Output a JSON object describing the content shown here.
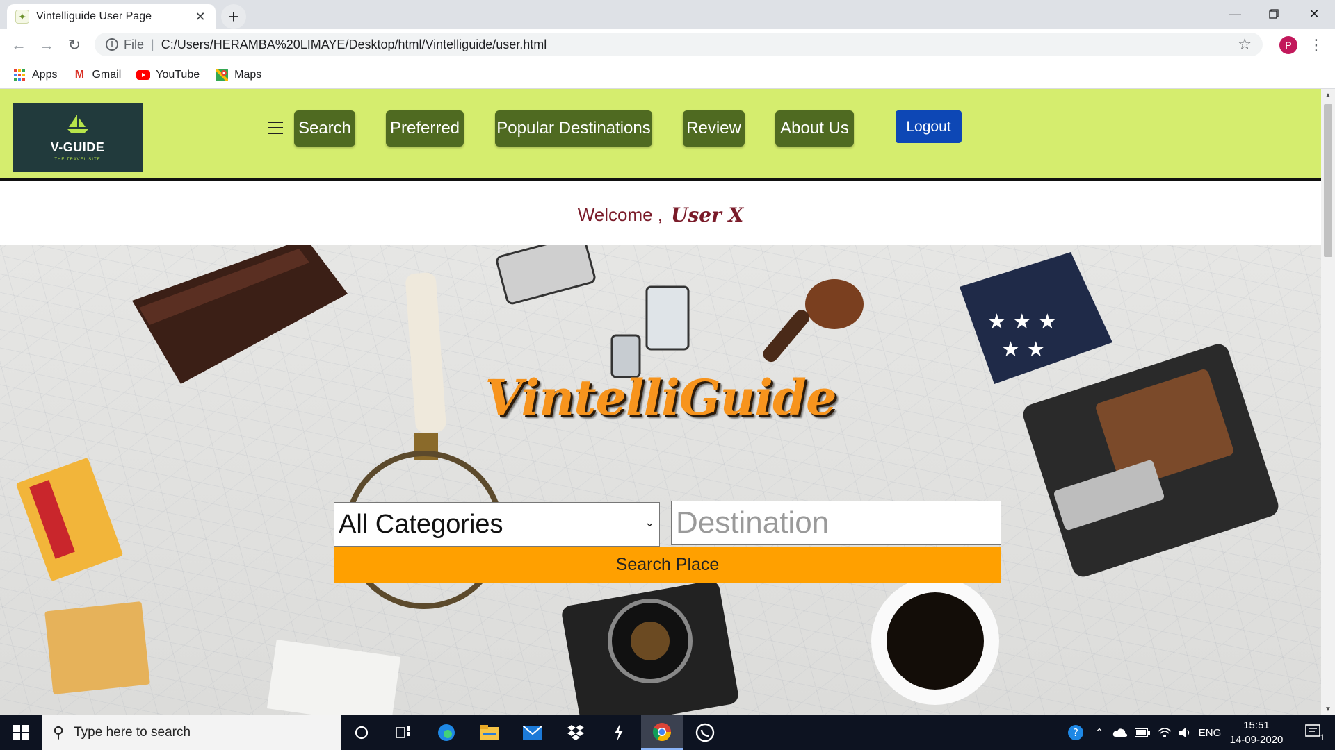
{
  "browser": {
    "tab_title": "Vintelliguide User Page",
    "tab_close": "✕",
    "new_tab": "+",
    "scheme": "File",
    "url": "C:/Users/HERAMBA%20LIMAYE/Desktop/html/Vintelliguide/user.html",
    "profile_initial": "P",
    "bookmarks": [
      {
        "label": "Apps",
        "icon": "apps-grid-icon"
      },
      {
        "label": "Gmail",
        "icon": "gmail-icon"
      },
      {
        "label": "YouTube",
        "icon": "youtube-icon"
      },
      {
        "label": "Maps",
        "icon": "maps-icon"
      }
    ]
  },
  "site": {
    "logo_brand": "V-GUIDE",
    "logo_tagline": "THE TRAVEL SITE",
    "nav": {
      "search": "Search",
      "preferred": "Preferred",
      "popular": "Popular Destinations",
      "review": "Review",
      "about": "About Us"
    },
    "logout": "Logout",
    "welcome_prefix": "Welcome ,",
    "welcome_user": "User X",
    "hero_title": "VintelliGuide",
    "category_selected": "All Categories",
    "destination_placeholder": "Destination",
    "search_button": "Search Place"
  },
  "taskbar": {
    "search_placeholder": "Type here to search",
    "language": "ENG",
    "time": "15:51",
    "date": "14-09-2020",
    "notification_count": "1"
  },
  "colors": {
    "header_bg": "#d5ed6e",
    "nav_button": "#4f6a21",
    "logout_button": "#0d47b5",
    "search_button": "#ffa000",
    "hero_title": "#f7941d",
    "welcome_text": "#7a1b29"
  }
}
